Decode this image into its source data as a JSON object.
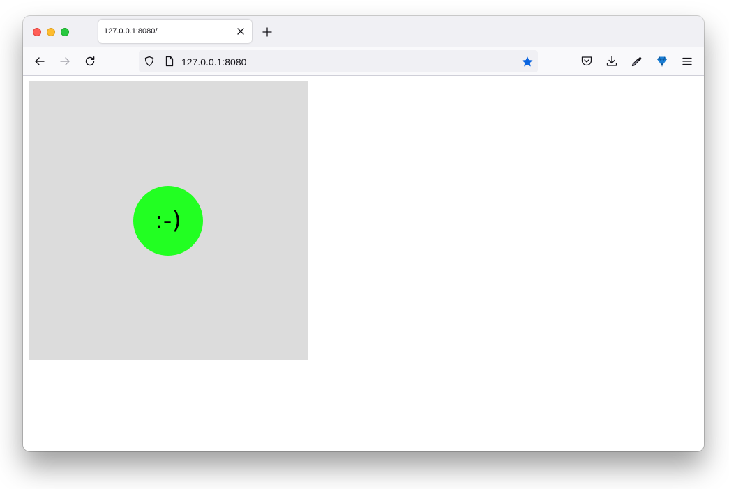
{
  "window": {
    "tab": {
      "title": "127.0.0.1:8080/"
    },
    "address_bar": {
      "url": "127.0.0.1:8080"
    },
    "icons": {
      "back": "back-arrow-icon",
      "forward": "forward-arrow-icon",
      "reload": "reload-icon",
      "shield": "tracking-protection-shield-icon",
      "page": "page-icon",
      "bookmark": "bookmark-star-icon",
      "pocket": "pocket-icon",
      "downloads": "download-icon",
      "eyedropper": "eyedropper-icon",
      "extension": "diamond-extension-icon",
      "menu": "hamburger-menu-icon"
    }
  },
  "page": {
    "face": {
      "text": ":-)",
      "color": "#22ff22"
    },
    "stage_background": "#dcdcdc",
    "accent_bookmark": "#0a64e0"
  }
}
